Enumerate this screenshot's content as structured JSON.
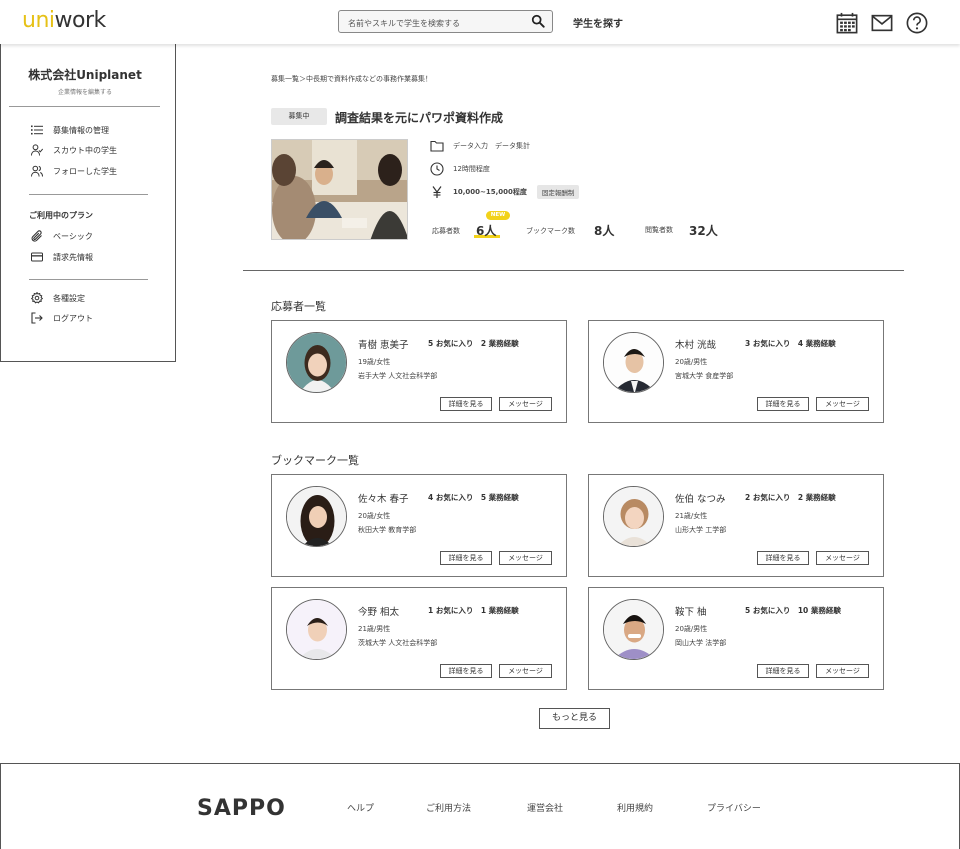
{
  "header": {
    "logo_uni": "uni",
    "logo_work": "work",
    "search_placeholder": "名前やスキルで学生を検索する",
    "find_students": "学生を探す",
    "icons": [
      "calendar-icon",
      "mail-icon",
      "help-icon"
    ]
  },
  "sidebar": {
    "company_name": "株式会社Uniplanet",
    "edit_link": "企業情報を編集する",
    "items": [
      {
        "label": "募集情報の管理",
        "icon": "list-icon"
      },
      {
        "label": "スカウト中の学生",
        "icon": "user-check-icon"
      },
      {
        "label": "フォローした学生",
        "icon": "users-icon"
      }
    ],
    "plan_section": "ご利用中のプラン",
    "plan_items": [
      {
        "label": "ベーシック",
        "icon": "paperclip-icon"
      },
      {
        "label": "請求先情報",
        "icon": "credit-card-icon"
      }
    ],
    "bottom_items": [
      {
        "label": "各種設定",
        "icon": "gear-icon"
      },
      {
        "label": "ログアウト",
        "icon": "logout-icon"
      }
    ]
  },
  "job": {
    "breadcrumb": "募集一覧＞中長期で資料作成などの事務作業募集！",
    "status": "募集中",
    "title": "調査結果を元にパワポ資料作成",
    "categories": "データ入力　データ集計",
    "hours": "12時間程度",
    "pay": "10,000~15,000程度",
    "pay_type": "固定報酬制",
    "applicants_label": "応募者数",
    "applicants_value": "6人",
    "new_badge": "NEW",
    "bookmarks_label": "ブックマーク数",
    "bookmarks_value": "8人",
    "views_label": "閲覧者数",
    "views_value": "32人"
  },
  "applicants_section": {
    "title": "応募者一覧",
    "cards": [
      {
        "name": "青樹 恵美子",
        "counts": "5 お気に入り　2 業務経験",
        "age": "19歳/女性",
        "school": "岩手大学 人文社会科学部",
        "detail": "詳細を見る",
        "message": "メッセージ"
      },
      {
        "name": "木村 洸哉",
        "counts": "3 お気に入り　4 業務経験",
        "age": "20歳/男性",
        "school": "宮城大学 食産学部",
        "detail": "詳細を見る",
        "message": "メッセージ"
      }
    ]
  },
  "bookmarks_section": {
    "title": "ブックマーク一覧",
    "cards": [
      {
        "name": "佐々木 春子",
        "counts": "4 お気に入り　5 業務経験",
        "age": "20歳/女性",
        "school": "秋田大学 教育学部",
        "detail": "詳細を見る",
        "message": "メッセージ"
      },
      {
        "name": "佐伯 なつみ",
        "counts": "2 お気に入り　2 業務経験",
        "age": "21歳/女性",
        "school": "山形大学 工学部",
        "detail": "詳細を見る",
        "message": "メッセージ"
      },
      {
        "name": "今野 相太",
        "counts": "1 お気に入り　1 業務経験",
        "age": "21歳/男性",
        "school": "茨城大学 人文社会科学部",
        "detail": "詳細を見る",
        "message": "メッセージ"
      },
      {
        "name": "鞍下 柚",
        "counts": "5 お気に入り　10 業務経験",
        "age": "20歳/男性",
        "school": "岡山大学 法学部",
        "detail": "詳細を見る",
        "message": "メッセージ"
      }
    ]
  },
  "more_button": "もっと見る",
  "footer": {
    "logo": "SAPPO",
    "links": [
      "ヘルプ",
      "ご利用方法",
      "運営会社",
      "利用規約",
      "プライバシー"
    ]
  },
  "colors": {
    "accent": "#e6c117",
    "new_badge": "#f2d21a"
  }
}
